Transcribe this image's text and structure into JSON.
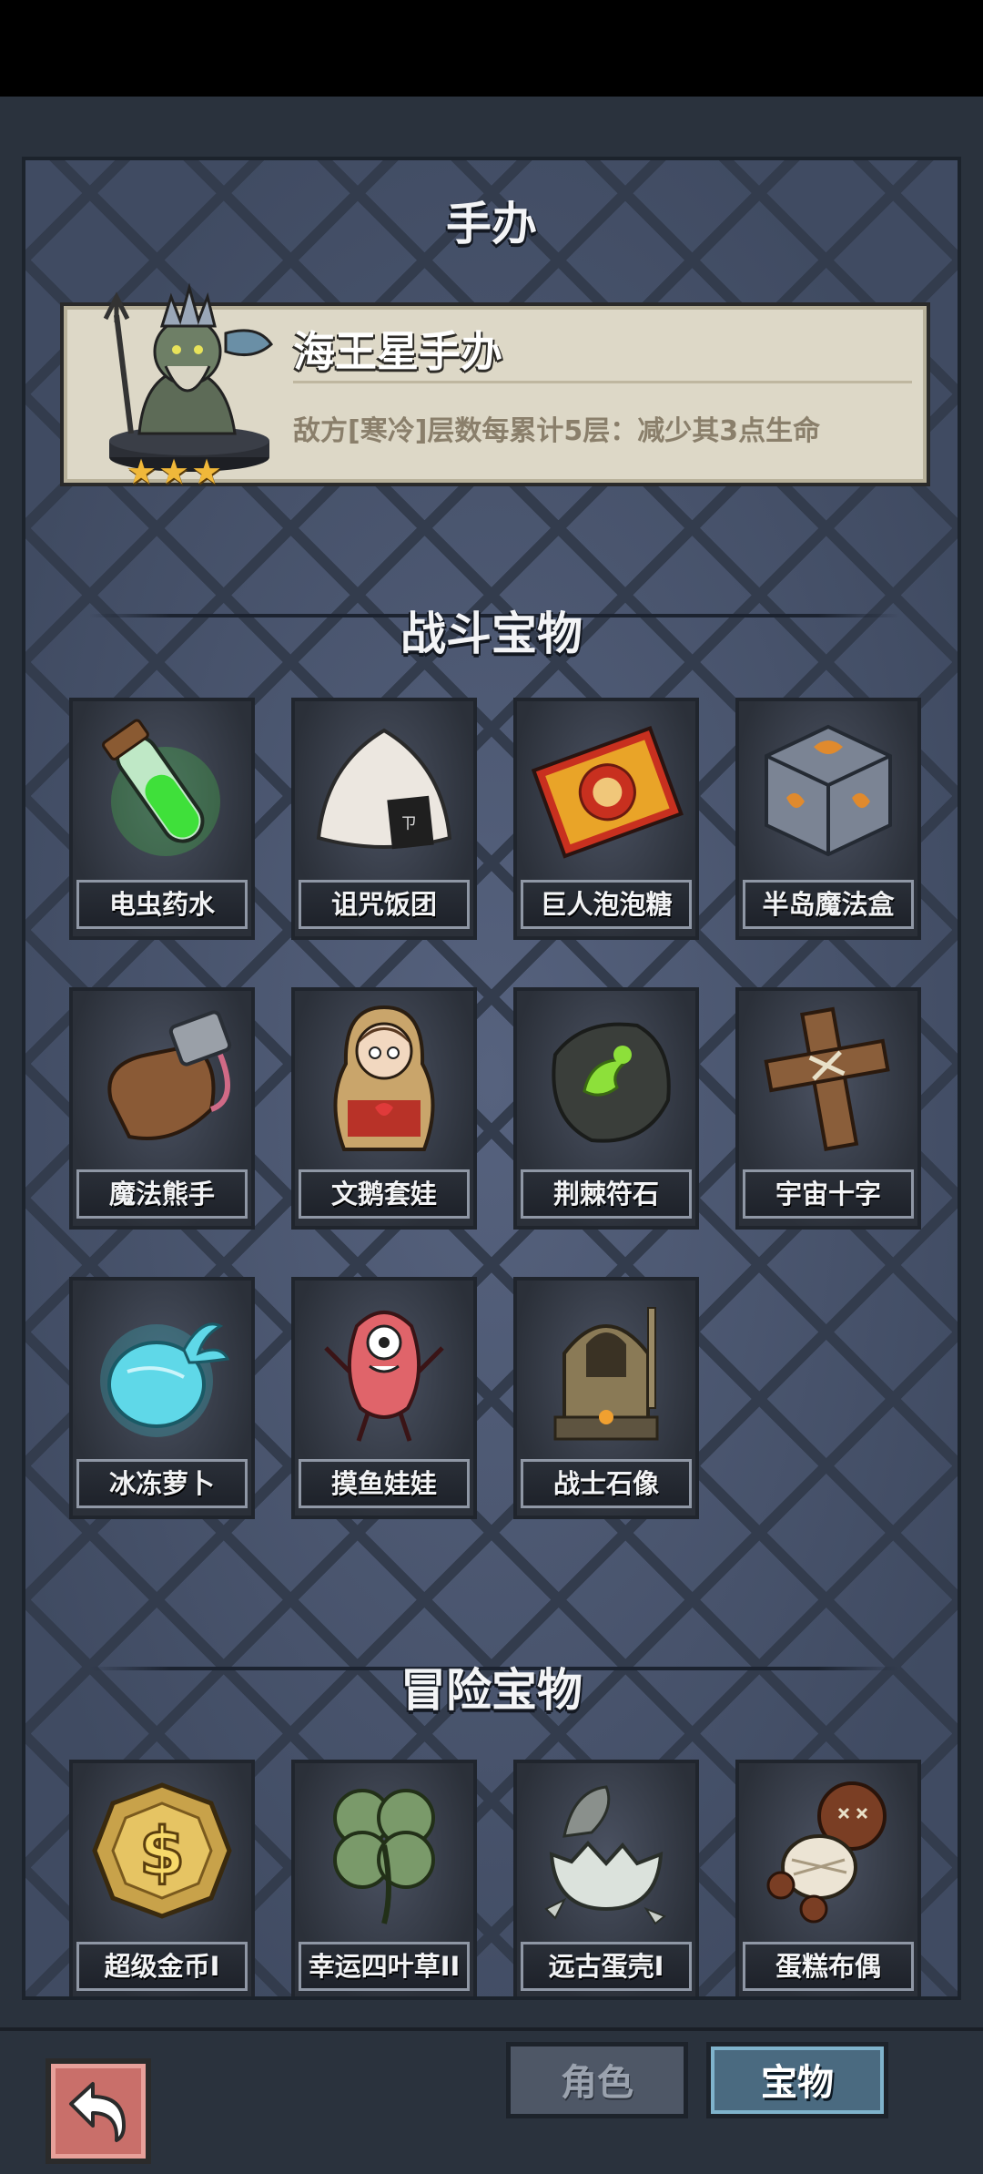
{
  "page_title": "手办",
  "figure": {
    "name": "海王星手办",
    "description": "敌方[寒冷]层数每累计5层：减少其3点生命",
    "stars": 3,
    "star_glyph": "★"
  },
  "battle_section": {
    "title": "战斗宝物",
    "items": [
      {
        "label": "电虫药水",
        "icon": "green-potion-icon"
      },
      {
        "label": "诅咒饭团",
        "icon": "rice-ball-icon"
      },
      {
        "label": "巨人泡泡糖",
        "icon": "bubble-gum-pack-icon"
      },
      {
        "label": "半岛魔法盒",
        "icon": "magic-cube-icon"
      },
      {
        "label": "魔法熊手",
        "icon": "bear-paw-icon"
      },
      {
        "label": "文鹅套娃",
        "icon": "nesting-doll-icon"
      },
      {
        "label": "荆棘符石",
        "icon": "rune-stone-icon"
      },
      {
        "label": "宇宙十字",
        "icon": "wooden-cross-icon"
      },
      {
        "label": "冰冻萝卜",
        "icon": "frozen-radish-icon"
      },
      {
        "label": "摸鱼娃娃",
        "icon": "pink-doll-icon"
      },
      {
        "label": "战士石像",
        "icon": "warrior-statue-icon"
      }
    ]
  },
  "adventure_section": {
    "title": "冒险宝物",
    "items": [
      {
        "label": "超级金币I",
        "icon": "gold-coin-icon"
      },
      {
        "label": "幸运四叶草II",
        "icon": "four-leaf-clover-icon"
      },
      {
        "label": "远古蛋壳I",
        "icon": "egg-shell-icon"
      },
      {
        "label": "蛋糕布偶",
        "icon": "cake-voodoo-doll-icon"
      }
    ]
  },
  "bottom_bar": {
    "tab_role": "角色",
    "tab_treasure": "宝物",
    "active_tab": "宝物"
  },
  "colors": {
    "panel": "#46516a",
    "card": "#ddd8c7",
    "star": "#f0b83a",
    "active_tab": "#4a6a80"
  }
}
